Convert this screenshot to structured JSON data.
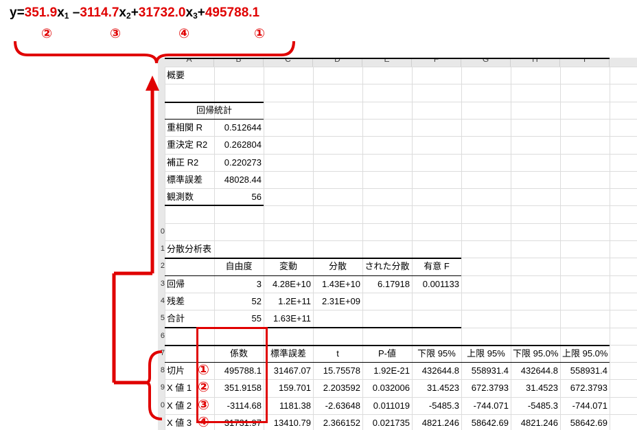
{
  "equation": {
    "y": "y=",
    "c1": "351.9",
    "x1": "x",
    "x1sub": "1",
    "minus": " –",
    "c2": "3114.7",
    "x2": "x",
    "x2sub": "2",
    "plus1": "+",
    "c3": "31732.0",
    "x3": "x",
    "x3sub": "3",
    "plus2": "+",
    "c4": "495788.1",
    "labels": [
      "②",
      "③",
      "④",
      "①"
    ]
  },
  "sheet": {
    "columns": [
      "A",
      "B",
      "C",
      "D",
      "E",
      "F",
      "G",
      "H",
      "I"
    ],
    "row_numbers": [
      "",
      "",
      "",
      "",
      "",
      "",
      "",
      "",
      "",
      "0",
      "1",
      "2",
      "3",
      "4",
      "5",
      "6",
      "7",
      "8",
      "9",
      "0"
    ],
    "summary_title": "概要",
    "regression_stats_title": "回帰統計",
    "regression_stats": [
      {
        "label": "重相関 R",
        "value": "0.512644"
      },
      {
        "label": "重決定 R2",
        "value": "0.262804"
      },
      {
        "label": "補正 R2",
        "value": "0.220273"
      },
      {
        "label": "標準誤差",
        "value": "48028.44"
      },
      {
        "label": "観測数",
        "value": "56"
      }
    ],
    "anova_title": "分散分析表",
    "anova_headers": [
      "",
      "自由度",
      "変動",
      "分散",
      "された分散",
      "有意 F"
    ],
    "anova_rows": [
      [
        "回帰",
        "3",
        "4.28E+10",
        "1.43E+10",
        "6.17918",
        "0.001133"
      ],
      [
        "残差",
        "52",
        "1.2E+11",
        "2.31E+09",
        "",
        ""
      ],
      [
        "合計",
        "55",
        "1.63E+11",
        "",
        "",
        ""
      ]
    ],
    "coef_headers": [
      "",
      "係数",
      "標準誤差",
      "t",
      "P-値",
      "下限 95%",
      "上限 95%",
      "下限 95.0%",
      "上限 95.0%"
    ],
    "coef_rows": [
      [
        "切片",
        "495788.1",
        "31467.07",
        "15.75578",
        "1.92E-21",
        "432644.8",
        "558931.4",
        "432644.8",
        "558931.4"
      ],
      [
        "X 値 1",
        "351.9158",
        "159.701",
        "2.203592",
        "0.032006",
        "31.4523",
        "672.3793",
        "31.4523",
        "672.3793"
      ],
      [
        "X 値 2",
        "-3114.68",
        "1181.38",
        "-2.63648",
        "0.011019",
        "-5485.3",
        "-744.071",
        "-5485.3",
        "-744.071"
      ],
      [
        "X 値 3",
        "31731.97",
        "13410.79",
        "2.366152",
        "0.021735",
        "4821.246",
        "58642.69",
        "4821.246",
        "58642.69"
      ]
    ],
    "coef_markers": [
      "①",
      "②",
      "③",
      "④"
    ]
  },
  "colors": {
    "accent_red": "#e00000"
  }
}
